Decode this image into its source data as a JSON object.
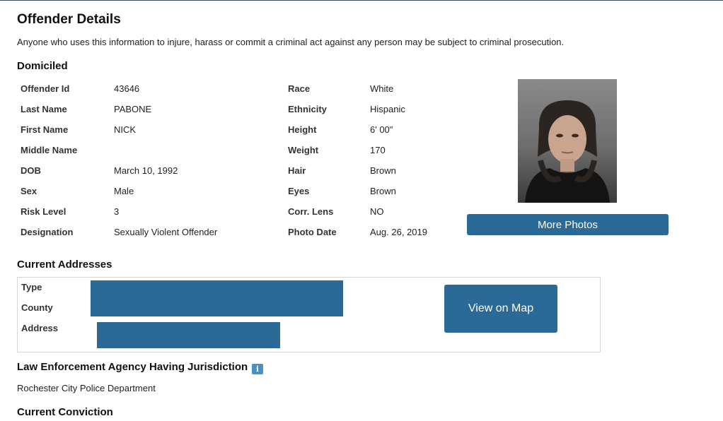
{
  "page": {
    "title": "Offender Details",
    "disclaimer": "Anyone who uses this information to injure, harass or commit a criminal act against any person may be subject to criminal prosecution."
  },
  "domiciled": {
    "heading": "Domiciled",
    "left": [
      {
        "label": "Offender Id",
        "value": "43646"
      },
      {
        "label": "Last Name",
        "value": "PABONE"
      },
      {
        "label": "First Name",
        "value": "NICK"
      },
      {
        "label": "Middle Name",
        "value": ""
      },
      {
        "label": "DOB",
        "value": "March 10, 1992"
      },
      {
        "label": "Sex",
        "value": "Male"
      },
      {
        "label": "Risk Level",
        "value": "3"
      },
      {
        "label": "Designation",
        "value": "Sexually Violent Offender"
      }
    ],
    "right": [
      {
        "label": "Race",
        "value": "White"
      },
      {
        "label": "Ethnicity",
        "value": "Hispanic"
      },
      {
        "label": "Height",
        "value": "6' 00\""
      },
      {
        "label": "Weight",
        "value": "170"
      },
      {
        "label": "Hair",
        "value": "Brown"
      },
      {
        "label": "Eyes",
        "value": "Brown"
      },
      {
        "label": "Corr. Lens",
        "value": "NO"
      },
      {
        "label": "Photo Date",
        "value": "Aug. 26, 2019"
      }
    ],
    "more_photos_label": "More Photos"
  },
  "addresses": {
    "heading": "Current Addresses",
    "type_label": "Type",
    "county_label": "County",
    "address_label": "Address",
    "redaction_color": "#2b6a97",
    "view_map_label": "View on Map"
  },
  "jurisdiction": {
    "heading": "Law Enforcement Agency Having Jurisdiction",
    "info_icon": "info-icon",
    "info_glyph": "i",
    "agency": "Rochester City Police Department"
  },
  "conviction": {
    "heading": "Current Conviction"
  },
  "colors": {
    "button": "#2b6a97",
    "info_icon": "#4a90c8"
  }
}
